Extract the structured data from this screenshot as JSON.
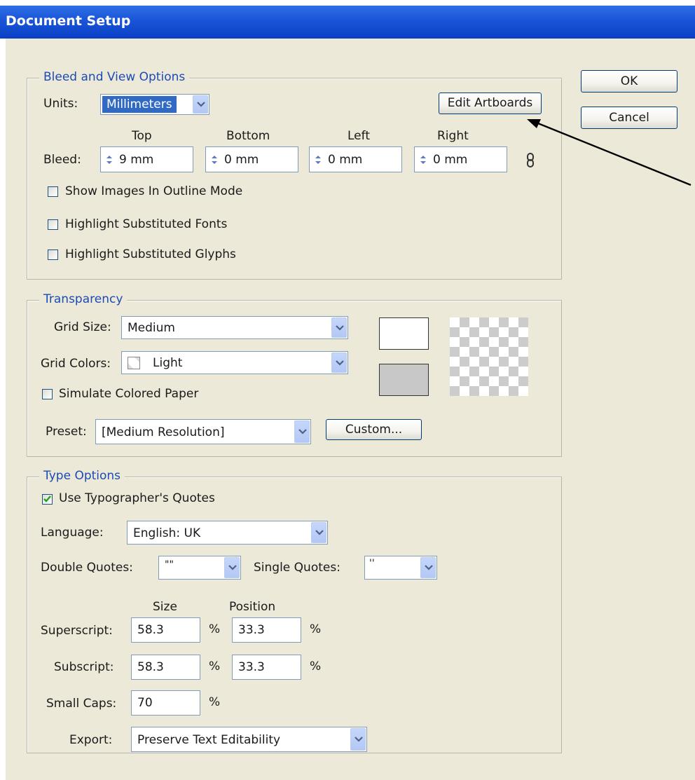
{
  "window": {
    "title": "Document Setup"
  },
  "buttons": {
    "ok": "OK",
    "cancel": "Cancel",
    "edit_artboards": "Edit Artboards",
    "custom": "Custom..."
  },
  "bleed_view": {
    "legend": "Bleed and View Options",
    "units_label": "Units:",
    "units_value": "Millimeters",
    "bleed_label": "Bleed:",
    "headers": {
      "top": "Top",
      "bottom": "Bottom",
      "left": "Left",
      "right": "Right"
    },
    "values": {
      "top": "9 mm",
      "bottom": "0 mm",
      "left": "0 mm",
      "right": "0 mm"
    },
    "checkboxes": [
      {
        "label": "Show Images In Outline Mode",
        "checked": false
      },
      {
        "label": "Highlight Substituted Fonts",
        "checked": false
      },
      {
        "label": "Highlight Substituted Glyphs",
        "checked": false
      }
    ]
  },
  "transparency": {
    "legend": "Transparency",
    "grid_size_label": "Grid Size:",
    "grid_size_value": "Medium",
    "grid_colors_label": "Grid Colors:",
    "grid_colors_value": "Light",
    "simulate_label": "Simulate Colored Paper",
    "simulate_checked": false,
    "preset_label": "Preset:",
    "preset_value": "[Medium Resolution]"
  },
  "type_options": {
    "legend": "Type Options",
    "use_quotes_label": "Use Typographer's Quotes",
    "use_quotes_checked": true,
    "language_label": "Language:",
    "language_value": "English: UK",
    "double_quotes_label": "Double Quotes:",
    "double_quotes_value": "\"\"",
    "single_quotes_label": "Single Quotes:",
    "single_quotes_value": "''",
    "size_header": "Size",
    "position_header": "Position",
    "superscript_label": "Superscript:",
    "superscript_size": "58.3",
    "superscript_position": "33.3",
    "subscript_label": "Subscript:",
    "subscript_size": "58.3",
    "subscript_position": "33.3",
    "small_caps_label": "Small Caps:",
    "small_caps_value": "70",
    "percent": "%",
    "export_label": "Export:",
    "export_value": "Preserve Text Editability"
  },
  "colors": {
    "title_bar": "#1a55d8",
    "dialog_bg": "#ece9d8",
    "legend_text": "#1c4bb5",
    "swatch_light": "#ffffff",
    "swatch_dark": "#c8c8c8"
  }
}
